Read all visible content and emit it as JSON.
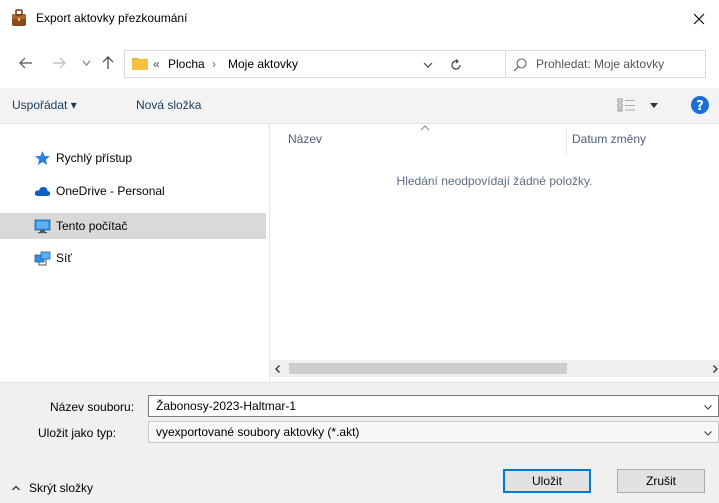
{
  "window": {
    "title": "Export aktovky přezkoumání"
  },
  "address": {
    "overflow": "«",
    "segments": [
      "Plocha",
      "Moje aktovky"
    ],
    "separator": "›"
  },
  "search": {
    "placeholder": "Prohledat: Moje aktovky"
  },
  "toolbar": {
    "organize_label": "Uspořádat ▾",
    "new_folder_label": "Nová složka"
  },
  "nav": {
    "items": [
      {
        "label": "Rychlý přístup",
        "icon": "star-icon"
      },
      {
        "label": "OneDrive - Personal",
        "icon": "cloud-icon"
      },
      {
        "label": "Tento počítač",
        "icon": "monitor-icon",
        "selected": true
      },
      {
        "label": "Síť",
        "icon": "network-icon"
      }
    ]
  },
  "files": {
    "columns": [
      "Název",
      "Datum změny"
    ],
    "empty_message": "Hledání neodpovídají žádné položky."
  },
  "form": {
    "filename_label": "Název souboru:",
    "filename_value": "Žabonosy-2023-Haltmar-1",
    "filetype_label": "Uložit jako typ:",
    "filetype_value": "vyexportované soubory aktovky (*.akt)"
  },
  "footer": {
    "hide_folders_label": "Skrýt složky",
    "save_label": "Uložit",
    "cancel_label": "Zrušit"
  },
  "colors": {
    "accent": "#0078d7",
    "folder": "#f5c242",
    "selected_bg": "#d9d9d9"
  }
}
